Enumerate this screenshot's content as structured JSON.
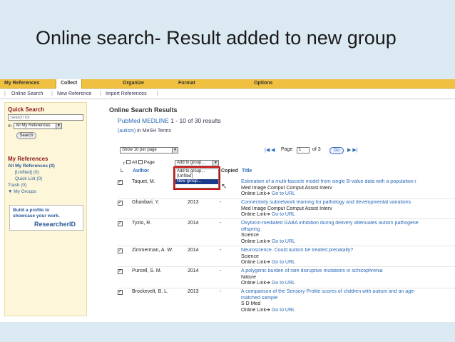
{
  "slide": {
    "title": "Online search- Result added to new group"
  },
  "topnav": {
    "my_references": "My References",
    "collect": "Collect",
    "organize": "Organize",
    "format": "Format",
    "options": "Options"
  },
  "subnav": {
    "online_search": "Online Search",
    "new_reference": "New Reference",
    "import_references": "Import References"
  },
  "sidebar": {
    "quick_search": "Quick Search",
    "search_placeholder": "Search for",
    "in_label": "in",
    "in_select": "All My References",
    "search_button": "Search",
    "my_references": "My References",
    "all_refs": "All My References (0)",
    "unfiled": "[Unfiled] (0)",
    "quick_list": "Quick List (0)",
    "trash": "Trash (0)",
    "my_groups": "My Groups",
    "rid_line1": "Build a profile to",
    "rid_line2": "showcase your work.",
    "rid_brand": "ResearcherID"
  },
  "main": {
    "heading": "Online Search Results",
    "db": "PubMed MEDLINE",
    "range": "1 - 10 of 30 results",
    "term": "(autism)",
    "term_suffix": "in MeSH Terms",
    "per_page": "Show 10 per page",
    "page_label": "Page",
    "page_value": "1",
    "of_label": "of 3",
    "go": "Go",
    "all_label": "All",
    "page_cb_label": "Page",
    "add_to_group": "Add to group...",
    "col_author": "Author",
    "col_copied": "Copied",
    "col_title": "Title"
  },
  "dropdown": {
    "options": [
      "Add to group...",
      "[Unfiled]",
      "New group..."
    ]
  },
  "rows": [
    {
      "author": "Taquet, M.",
      "year": "",
      "copied": "",
      "title": "Estimation of a multi-fascicle model from single B-value data with a population-i",
      "source": "Med Image Comput Comput Assist Interv",
      "link": "Online Link",
      "url": "Go to URL"
    },
    {
      "author": "Ghanbari, Y.",
      "year": "2013",
      "copied": "-",
      "title": "Connectivity subnetwork learning for pathology and developmental variations",
      "source": "Med Image Comput Comput Assist Interv",
      "link": "Online Link",
      "url": "Go to URL"
    },
    {
      "author": "Tyzio, R.",
      "year": "2014",
      "copied": "-",
      "title": "Oxytocin-mediated GABA inhibition during delivery attenuates autism pathogene",
      "title2": "offspring",
      "source": "Science",
      "link": "Online Link",
      "url": "Go to URL"
    },
    {
      "author": "Zimmerman, A. W.",
      "year": "2014",
      "copied": "-",
      "title": "Neuroscience. Could autism be treated prenatally?",
      "source": "Science",
      "link": "Online Link",
      "url": "Go to URL"
    },
    {
      "author": "Purcell, S. M.",
      "year": "2014",
      "copied": "-",
      "title": "A polygenic burden of rare disruptive mutations in schizophrenia",
      "source": "Nature",
      "link": "Online Link",
      "url": "Go to URL"
    },
    {
      "author": "Brockevelt, B. L.",
      "year": "2013",
      "copied": "-",
      "title": "A comparison of the Sensory Profile scores of children with autism and an age-",
      "title2": "matched sample",
      "source": "S D Med",
      "link": "Online Link",
      "url": "Go to URL"
    }
  ]
}
